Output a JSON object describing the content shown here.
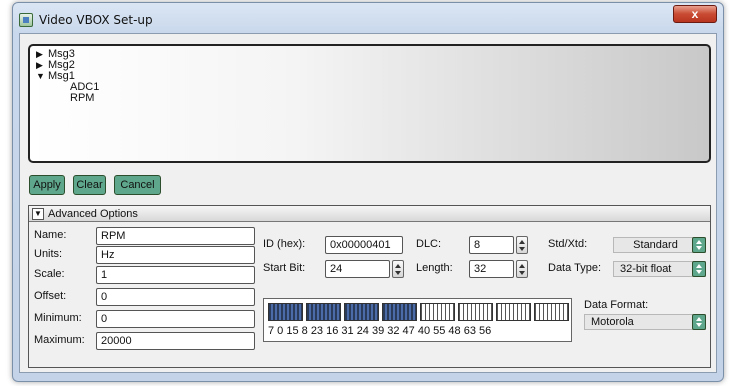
{
  "window": {
    "title": "Video VBOX Set-up",
    "close_label": "x"
  },
  "tree": {
    "items": [
      {
        "arrow": "▶",
        "label": "Msg3"
      },
      {
        "arrow": "▶",
        "label": "Msg2"
      },
      {
        "arrow": "▼",
        "label": "Msg1",
        "children": [
          "ADC1",
          "RPM"
        ]
      }
    ]
  },
  "buttons": {
    "apply": "Apply",
    "clear": "Clear",
    "cancel": "Cancel"
  },
  "advanced": {
    "header": "Advanced Options",
    "toggle": "▼",
    "name_label": "Name:",
    "name_value": "RPM",
    "units_label": "Units:",
    "units_value": "Hz",
    "scale_label": "Scale:",
    "scale_value": "1",
    "offset_label": "Offset:",
    "offset_value": "0",
    "minimum_label": "Minimum:",
    "minimum_value": "0",
    "maximum_label": "Maximum:",
    "maximum_value": "20000",
    "id_label": "ID (hex):",
    "id_value": "0x00000401",
    "dlc_label": "DLC:",
    "dlc_value": "8",
    "startbit_label": "Start Bit:",
    "startbit_value": "24",
    "length_label": "Length:",
    "length_value": "32",
    "stdxtd_label": "Std/Xtd:",
    "stdxtd_value": "Standard",
    "datatype_label": "Data Type:",
    "datatype_value": "32-bit float",
    "dataformat_label": "Data Format:",
    "dataformat_value": "Motorola",
    "bit_labels": "7   0  15  8   23  16  31  24  39  32  47  40  55  48  63  56",
    "bytes_active": [
      true,
      true,
      true,
      true,
      false,
      false,
      false,
      false
    ]
  }
}
